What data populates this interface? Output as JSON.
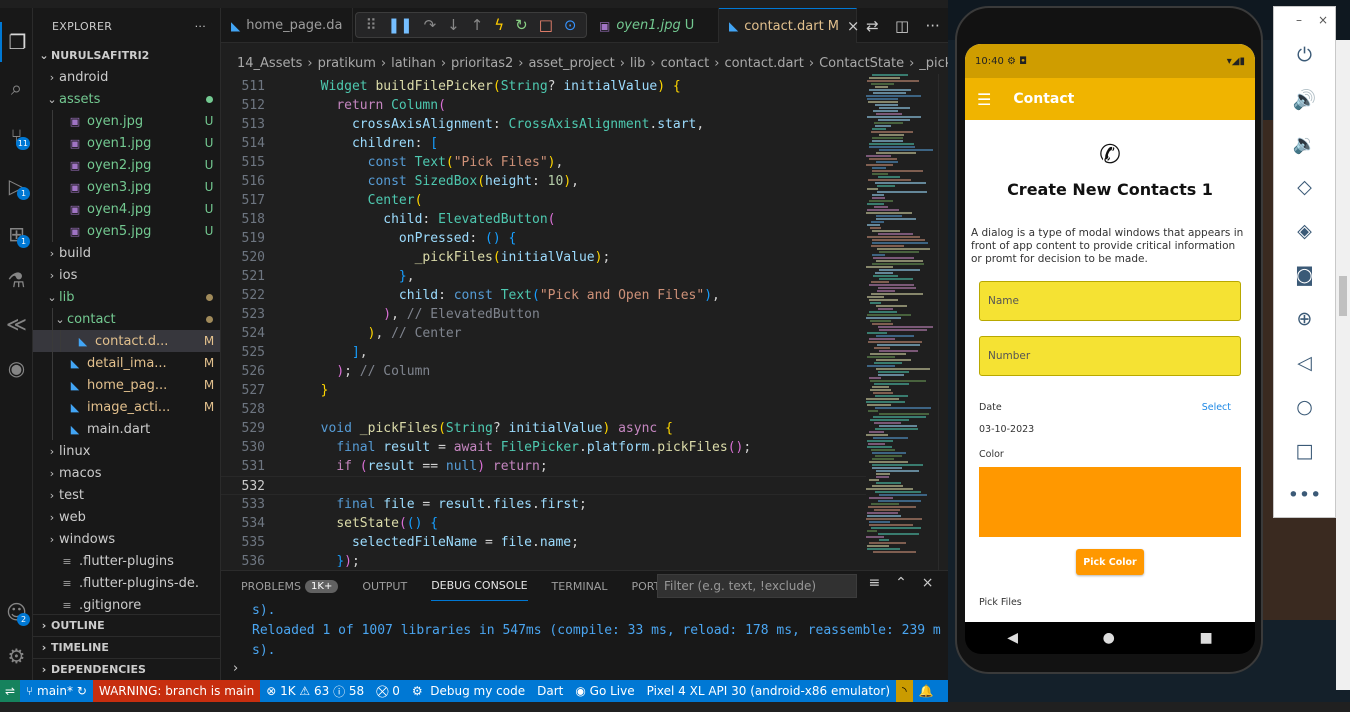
{
  "window": {
    "title": "nurulsafitri2"
  },
  "activity_bar": {
    "scm_badge": "11",
    "run_badge": "1",
    "ext_badge": "1",
    "account_badge": "2"
  },
  "sidebar": {
    "title": "EXPLORER",
    "more": "···",
    "root": "NURULSAFITRI2",
    "items": [
      {
        "label": "android",
        "status": "",
        "depth": 1,
        "kind": "folder"
      },
      {
        "label": "assets",
        "status": "●",
        "depth": 1,
        "kind": "folder-open"
      },
      {
        "label": "oyen.jpg",
        "status": "U",
        "depth": 2,
        "kind": "image"
      },
      {
        "label": "oyen1.jpg",
        "status": "U",
        "depth": 2,
        "kind": "image"
      },
      {
        "label": "oyen2.jpg",
        "status": "U",
        "depth": 2,
        "kind": "image"
      },
      {
        "label": "oyen3.jpg",
        "status": "U",
        "depth": 2,
        "kind": "image"
      },
      {
        "label": "oyen4.jpg",
        "status": "U",
        "depth": 2,
        "kind": "image"
      },
      {
        "label": "oyen5.jpg",
        "status": "U",
        "depth": 2,
        "kind": "image"
      },
      {
        "label": "build",
        "status": "",
        "depth": 1,
        "kind": "folder"
      },
      {
        "label": "ios",
        "status": "",
        "depth": 1,
        "kind": "folder"
      },
      {
        "label": "lib",
        "status": "●",
        "depth": 1,
        "kind": "folder-open"
      },
      {
        "label": "contact",
        "status": "●",
        "depth": 2,
        "kind": "folder-open"
      },
      {
        "label": "contact.d...",
        "status": "M",
        "depth": 3,
        "kind": "dart"
      },
      {
        "label": "detail_ima...",
        "status": "M",
        "depth": 2,
        "kind": "dart"
      },
      {
        "label": "home_pag...",
        "status": "M",
        "depth": 2,
        "kind": "dart"
      },
      {
        "label": "image_acti...",
        "status": "M",
        "depth": 2,
        "kind": "dart"
      },
      {
        "label": "main.dart",
        "status": "",
        "depth": 2,
        "kind": "dart"
      },
      {
        "label": "linux",
        "status": "",
        "depth": 1,
        "kind": "folder"
      },
      {
        "label": "macos",
        "status": "",
        "depth": 1,
        "kind": "folder"
      },
      {
        "label": "test",
        "status": "",
        "depth": 1,
        "kind": "folder"
      },
      {
        "label": "web",
        "status": "",
        "depth": 1,
        "kind": "folder"
      },
      {
        "label": "windows",
        "status": "",
        "depth": 1,
        "kind": "folder"
      },
      {
        "label": ".flutter-plugins",
        "status": "",
        "depth": 1,
        "kind": "file"
      },
      {
        "label": ".flutter-plugins-de...",
        "status": "",
        "depth": 1,
        "kind": "file"
      },
      {
        "label": ".gitignore",
        "status": "",
        "depth": 1,
        "kind": "file"
      }
    ],
    "sections": [
      "OUTLINE",
      "TIMELINE",
      "DEPENDENCIES"
    ]
  },
  "tabs": [
    {
      "label": "home_page.da",
      "modified": "",
      "active": false,
      "italic": false
    },
    {
      "label": "oyen1.jpg",
      "modified": "U",
      "active": false,
      "italic": true
    },
    {
      "label": "contact.dart",
      "modified": "M",
      "active": true,
      "italic": false
    }
  ],
  "breadcrumb": [
    "14_Assets",
    "pratikum",
    "latihan",
    "prioritas2",
    "asset_project",
    "lib",
    "contact",
    "contact.dart",
    "ContactState",
    "_pickF"
  ],
  "editor": {
    "lines": [
      {
        "n": "511",
        "html": "  <span class='t'>Widget</span> <span class='f'>buildFilePicker</span><span class='y'>(</span><span class='t'>String</span><span class='p'>? </span><span class='v'>initialValue</span><span class='y'>)</span> <span class='y'>{</span>"
      },
      {
        "n": "512",
        "html": "    <span class='k'>return</span> <span class='t'>Column</span><span class='pp'>(</span>"
      },
      {
        "n": "513",
        "html": "      <span class='v'>crossAxisAlignment</span><span class='p'>: </span><span class='t'>CrossAxisAlignment</span><span class='p'>.</span><span class='v'>start</span><span class='p'>,</span>"
      },
      {
        "n": "514",
        "html": "      <span class='v'>children</span><span class='p'>: </span><span class='bl'>[</span>"
      },
      {
        "n": "515",
        "html": "        <span class='kw'>const</span> <span class='t'>Text</span><span class='y'>(</span><span class='s'>\"Pick Files\"</span><span class='y'>)</span><span class='p'>,</span>"
      },
      {
        "n": "516",
        "html": "        <span class='kw'>const</span> <span class='t'>SizedBox</span><span class='y'>(</span><span class='v'>height</span><span class='p'>: </span><span class='n'>10</span><span class='y'>)</span><span class='p'>,</span>"
      },
      {
        "n": "517",
        "html": "        <span class='t'>Center</span><span class='y'>(</span>"
      },
      {
        "n": "518",
        "html": "          <span class='v'>child</span><span class='p'>: </span><span class='t'>ElevatedButton</span><span class='pp'>(</span>"
      },
      {
        "n": "519",
        "html": "            <span class='v'>onPressed</span><span class='p'>: </span><span class='bl'>()</span> <span class='bl'>{</span>"
      },
      {
        "n": "520",
        "html": "              <span class='f'>_pickFiles</span><span class='y'>(</span><span class='v'>initialValue</span><span class='y'>)</span><span class='p'>;</span>"
      },
      {
        "n": "521",
        "html": "            <span class='bl'>}</span><span class='p'>,</span>"
      },
      {
        "n": "522",
        "html": "            <span class='v'>child</span><span class='p'>: </span><span class='kw'>const</span> <span class='t'>Text</span><span class='bl'>(</span><span class='s'>\"Pick and Open Files\"</span><span class='bl'>)</span><span class='p'>,</span>"
      },
      {
        "n": "523",
        "html": "          <span class='pp'>)</span><span class='p'>, </span><span class='cm'>// ElevatedButton</span>"
      },
      {
        "n": "524",
        "html": "        <span class='y'>)</span><span class='p'>, </span><span class='cm'>// Center</span>"
      },
      {
        "n": "525",
        "html": "      <span class='bl'>]</span><span class='p'>,</span>"
      },
      {
        "n": "526",
        "html": "    <span class='pp'>)</span><span class='p'>; </span><span class='cm'>// Column</span>"
      },
      {
        "n": "527",
        "html": "  <span class='y'>}</span>"
      },
      {
        "n": "528",
        "html": ""
      },
      {
        "n": "529",
        "html": "  <span class='kw'>void</span> <span class='f'>_pickFiles</span><span class='y'>(</span><span class='t'>String</span><span class='p'>? </span><span class='v'>initialValue</span><span class='y'>)</span> <span class='k'>async</span> <span class='y'>{</span>"
      },
      {
        "n": "530",
        "html": "    <span class='kw'>final</span> <span class='v'>result</span> <span class='p'>= </span><span class='k'>await</span> <span class='t'>FilePicker</span><span class='p'>.</span><span class='v'>platform</span><span class='p'>.</span><span class='f'>pickFiles</span><span class='pp'>()</span><span class='p'>;</span>"
      },
      {
        "n": "531",
        "html": "    <span class='k'>if</span> <span class='pp'>(</span><span class='v'>result</span> <span class='p'>== </span><span class='kw'>null</span><span class='pp'>)</span> <span class='k'>return</span><span class='p'>;</span>"
      },
      {
        "n": "532",
        "html": "",
        "current": true
      },
      {
        "n": "533",
        "html": "    <span class='kw'>final</span> <span class='v'>file</span> <span class='p'>= </span><span class='v'>result</span><span class='p'>.</span><span class='v'>files</span><span class='p'>.</span><span class='v'>first</span><span class='p'>;</span>"
      },
      {
        "n": "534",
        "html": "    <span class='f'>setState</span><span class='pp'>(</span><span class='bl'>()</span> <span class='bl'>{</span>"
      },
      {
        "n": "535",
        "html": "      <span class='v'>selectedFileName</span> <span class='p'>= </span><span class='v'>file</span><span class='p'>.</span><span class='v'>name</span><span class='p'>;</span>"
      },
      {
        "n": "536",
        "html": "    <span class='bl'>}</span><span class='pp'>)</span><span class='p'>;</span>"
      }
    ]
  },
  "panel": {
    "tabs": [
      {
        "label": "PROBLEMS",
        "badge": "1K+",
        "active": false
      },
      {
        "label": "OUTPUT",
        "badge": "",
        "active": false
      },
      {
        "label": "DEBUG CONSOLE",
        "badge": "",
        "active": true
      },
      {
        "label": "TERMINAL",
        "badge": "",
        "active": false
      },
      {
        "label": "PORTS",
        "badge": "",
        "active": false
      }
    ],
    "filter_placeholder": "Filter (e.g. text, !exclude)",
    "output": [
      "s).",
      "Reloaded 1 of 1007 libraries in 547ms (compile: 33 ms, reload: 178 ms, reassemble: 239 m",
      "s)."
    ],
    "prompt": "›"
  },
  "statusbar": {
    "remote": "⇌",
    "branch": "main*",
    "warning": "WARNING: branch is main",
    "errors": "1K",
    "warnings": "63",
    "infos": "58",
    "ports": "0",
    "debug": "Debug my code",
    "language": "Dart",
    "golive": "Go Live",
    "device": "Pixel 4 XL API 30 (android-x86 emulator)"
  },
  "phone": {
    "time": "10:40",
    "status_icons": "⚙ ◘",
    "signal": "▾◢▮",
    "app_title": "Contact",
    "heading": "Create New Contacts 1",
    "description": "A dialog is a type of modal windows that appears in front of app content to provide critical information or promt for decision to be made.",
    "name_placeholder": "Name",
    "number_placeholder": "Number",
    "date_label": "Date",
    "date_select": "Select",
    "date_value": "03-10-2023",
    "color_label": "Color",
    "color_value": "#ff9800",
    "pick_color": "Pick Color",
    "pick_files": "Pick Files"
  },
  "emulator_panel": {
    "minimize": "–",
    "close": "×"
  }
}
